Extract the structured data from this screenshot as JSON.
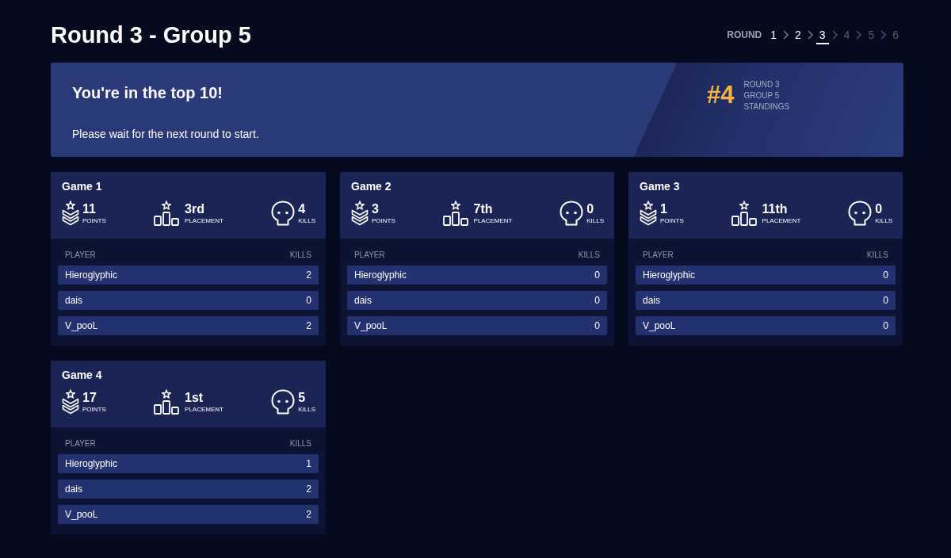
{
  "header": {
    "title": "Round 3 - Group 5",
    "round_nav": {
      "label": "ROUND",
      "rounds": [
        {
          "label": "1",
          "selected": false,
          "disabled": false
        },
        {
          "label": "2",
          "selected": false,
          "disabled": false
        },
        {
          "label": "3",
          "selected": true,
          "disabled": false
        },
        {
          "label": "4",
          "selected": false,
          "disabled": true
        },
        {
          "label": "5",
          "selected": false,
          "disabled": true
        },
        {
          "label": "6",
          "selected": false,
          "disabled": true
        }
      ]
    }
  },
  "banner": {
    "title": "You're in the top 10!",
    "message": "Please wait for the next round to start.",
    "rank": "#4",
    "rank_labels": [
      "ROUND 3",
      "GROUP 5",
      "STANDINGS"
    ]
  },
  "games": [
    {
      "title": "Game 1",
      "stats": [
        {
          "kind": "points",
          "value": "11",
          "label": "POINTS"
        },
        {
          "kind": "placement",
          "value": "3rd",
          "label": "PLACEMENT"
        },
        {
          "kind": "kills",
          "value": "4",
          "label": "KILLS"
        }
      ],
      "columns": [
        "PLAYER",
        "KILLS"
      ],
      "players": [
        {
          "name": "Hieroglyphic",
          "kills": "2"
        },
        {
          "name": "dais",
          "kills": "0"
        },
        {
          "name": "V_pooL",
          "kills": "2"
        }
      ]
    },
    {
      "title": "Game 2",
      "stats": [
        {
          "kind": "points",
          "value": "3",
          "label": "POINTS"
        },
        {
          "kind": "placement",
          "value": "7th",
          "label": "PLACEMENT"
        },
        {
          "kind": "kills",
          "value": "0",
          "label": "KILLS"
        }
      ],
      "columns": [
        "PLAYER",
        "KILLS"
      ],
      "players": [
        {
          "name": "Hieroglyphic",
          "kills": "0"
        },
        {
          "name": "dais",
          "kills": "0"
        },
        {
          "name": "V_pooL",
          "kills": "0"
        }
      ]
    },
    {
      "title": "Game 3",
      "stats": [
        {
          "kind": "points",
          "value": "1",
          "label": "POINTS"
        },
        {
          "kind": "placement",
          "value": "11th",
          "label": "PLACEMENT"
        },
        {
          "kind": "kills",
          "value": "0",
          "label": "KILLS"
        }
      ],
      "columns": [
        "PLAYER",
        "KILLS"
      ],
      "players": [
        {
          "name": "Hieroglyphic",
          "kills": "0"
        },
        {
          "name": "dais",
          "kills": "0"
        },
        {
          "name": "V_pooL",
          "kills": "0"
        }
      ]
    },
    {
      "title": "Game 4",
      "stats": [
        {
          "kind": "points",
          "value": "17",
          "label": "POINTS"
        },
        {
          "kind": "placement",
          "value": "1st",
          "label": "PLACEMENT"
        },
        {
          "kind": "kills",
          "value": "5",
          "label": "KILLS"
        }
      ],
      "columns": [
        "PLAYER",
        "KILLS"
      ],
      "players": [
        {
          "name": "Hieroglyphic",
          "kills": "1"
        },
        {
          "name": "dais",
          "kills": "2"
        },
        {
          "name": "V_pooL",
          "kills": "2"
        }
      ]
    }
  ]
}
